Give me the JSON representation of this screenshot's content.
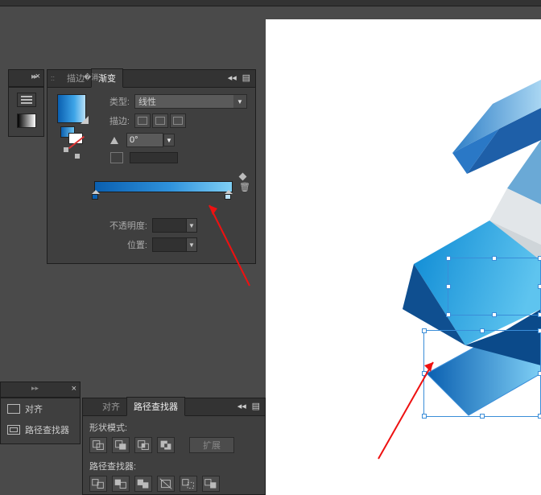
{
  "panel": {
    "tabs": {
      "stroke": "描边",
      "gradient": "渐变"
    },
    "type_label": "类型:",
    "type_value": "线性",
    "stroke_label": "描边:",
    "angle_value": "0°",
    "opacity_label": "不透明度:",
    "position_label": "位置:"
  },
  "bottom_left": {
    "align": "对齐",
    "pathfinder": "路径查找器"
  },
  "bottom_panel": {
    "tabs": {
      "align": "对齐",
      "pathfinder": "路径查找器"
    },
    "shape_mode_label": "形状模式:",
    "expand_label": "扩展",
    "pathfinder_label": "路径查找器:"
  },
  "icons": {
    "menu": "menu-icon",
    "close": "×",
    "flyout": "◂◂",
    "dd": "▼",
    "trash": "🗑"
  }
}
